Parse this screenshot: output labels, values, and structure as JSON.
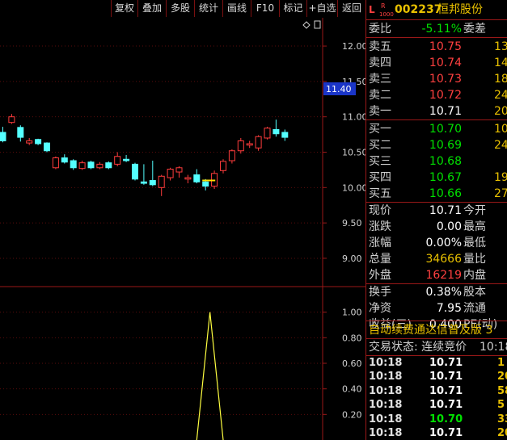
{
  "toolbar": {
    "items": [
      {
        "label": "复权"
      },
      {
        "label": "叠加"
      },
      {
        "label": "多股"
      },
      {
        "label": "统计"
      },
      {
        "label": "画线"
      },
      {
        "label": "F10"
      },
      {
        "label": "标记"
      },
      {
        "label": "+自选"
      },
      {
        "label": "返回"
      }
    ]
  },
  "chart": {
    "current_price_tag": "11.40",
    "price_axis": [
      "12.00",
      "11.50",
      "11.00",
      "10.50",
      "10.00",
      "9.50",
      "9.00"
    ],
    "indicator_axis": [
      "1.00",
      "0.80",
      "0.60",
      "0.40",
      "0.20"
    ]
  },
  "chart_data": {
    "type": "candlestick",
    "ylim": [
      8.6,
      12.4
    ],
    "candles": [
      {
        "o": 10.78,
        "h": 10.86,
        "l": 10.64,
        "c": 10.66
      },
      {
        "o": 10.92,
        "h": 11.04,
        "l": 10.9,
        "c": 11.0
      },
      {
        "o": 10.85,
        "h": 10.88,
        "l": 10.65,
        "c": 10.71
      },
      {
        "o": 10.63,
        "h": 10.7,
        "l": 10.6,
        "c": 10.66
      },
      {
        "o": 10.68,
        "h": 10.69,
        "l": 10.6,
        "c": 10.62
      },
      {
        "o": 10.63,
        "h": 10.64,
        "l": 10.5,
        "c": 10.52
      },
      {
        "o": 10.28,
        "h": 10.44,
        "l": 10.26,
        "c": 10.42
      },
      {
        "o": 10.42,
        "h": 10.47,
        "l": 10.34,
        "c": 10.36
      },
      {
        "o": 10.38,
        "h": 10.4,
        "l": 10.25,
        "c": 10.28
      },
      {
        "o": 10.27,
        "h": 10.38,
        "l": 10.25,
        "c": 10.35
      },
      {
        "o": 10.36,
        "h": 10.38,
        "l": 10.26,
        "c": 10.28
      },
      {
        "o": 10.28,
        "h": 10.36,
        "l": 10.26,
        "c": 10.33
      },
      {
        "o": 10.35,
        "h": 10.37,
        "l": 10.26,
        "c": 10.28
      },
      {
        "o": 10.33,
        "h": 10.5,
        "l": 10.3,
        "c": 10.44
      },
      {
        "o": 10.4,
        "h": 10.46,
        "l": 10.36,
        "c": 10.38
      },
      {
        "o": 10.33,
        "h": 10.35,
        "l": 10.1,
        "c": 10.12
      },
      {
        "o": 10.08,
        "h": 10.33,
        "l": 10.04,
        "c": 10.06
      },
      {
        "o": 10.1,
        "h": 10.38,
        "l": 10.02,
        "c": 10.04
      },
      {
        "o": 10.0,
        "h": 10.18,
        "l": 9.88,
        "c": 10.16
      },
      {
        "o": 10.14,
        "h": 10.28,
        "l": 10.1,
        "c": 10.26
      },
      {
        "o": 10.22,
        "h": 10.3,
        "l": 10.14,
        "c": 10.28
      },
      {
        "o": 10.12,
        "h": 10.18,
        "l": 10.06,
        "c": 10.14
      },
      {
        "o": 10.18,
        "h": 10.26,
        "l": 10.06,
        "c": 10.08
      },
      {
        "o": 10.08,
        "h": 10.12,
        "l": 9.96,
        "c": 10.02
      },
      {
        "o": 10.02,
        "h": 10.24,
        "l": 9.98,
        "c": 10.2
      },
      {
        "o": 10.24,
        "h": 10.4,
        "l": 10.2,
        "c": 10.37
      },
      {
        "o": 10.38,
        "h": 10.54,
        "l": 10.34,
        "c": 10.52
      },
      {
        "o": 10.52,
        "h": 10.7,
        "l": 10.48,
        "c": 10.66
      },
      {
        "o": 10.6,
        "h": 10.66,
        "l": 10.56,
        "c": 10.62
      },
      {
        "o": 10.56,
        "h": 10.74,
        "l": 10.52,
        "c": 10.72
      },
      {
        "o": 10.7,
        "h": 10.86,
        "l": 10.68,
        "c": 10.84
      },
      {
        "o": 10.82,
        "h": 10.96,
        "l": 10.72,
        "c": 10.76
      },
      {
        "o": 10.78,
        "h": 10.82,
        "l": 10.66,
        "c": 10.71
      }
    ],
    "highlight_index": 23,
    "highlight_price": 10.1,
    "indicator": {
      "ylim": [
        0,
        1.2
      ],
      "segments": [
        {
          "from_index": 22,
          "to_index": 25,
          "values": [
            0,
            1.0,
            0
          ]
        }
      ]
    }
  },
  "quote": {
    "stock_code": "002237",
    "stock_name": "恒邦股份",
    "tag_l": "L",
    "tag_r": "R",
    "tag_num": "1000",
    "webi_label": "委比",
    "webi_value": "-5.11%",
    "weicha_label": "委差",
    "sell": [
      {
        "label": "卖五",
        "price": "10.75",
        "vol": "13"
      },
      {
        "label": "卖四",
        "price": "10.74",
        "vol": "14"
      },
      {
        "label": "卖三",
        "price": "10.73",
        "vol": "18"
      },
      {
        "label": "卖二",
        "price": "10.72",
        "vol": "24"
      },
      {
        "label": "卖一",
        "price": "10.71",
        "vol": "20"
      }
    ],
    "buy": [
      {
        "label": "买一",
        "price": "10.70",
        "vol": "10"
      },
      {
        "label": "买二",
        "price": "10.69",
        "vol": "24"
      },
      {
        "label": "买三",
        "price": "10.68",
        "vol": ""
      },
      {
        "label": "买四",
        "price": "10.67",
        "vol": "19"
      },
      {
        "label": "买五",
        "price": "10.66",
        "vol": "27"
      }
    ],
    "stats": [
      {
        "label": "现价",
        "value": "10.71",
        "label2": "今开"
      },
      {
        "label": "涨跌",
        "value": "0.00",
        "label2": "最高"
      },
      {
        "label": "涨幅",
        "value": "0.00%",
        "label2": "最低"
      },
      {
        "label": "总量",
        "value": "34666",
        "label2": "量比"
      },
      {
        "label": "外盘",
        "value": "16219",
        "label2": "内盘"
      }
    ],
    "stats2": [
      {
        "label": "换手",
        "value": "0.38%",
        "label2": "股本"
      },
      {
        "label": "净资",
        "value": "7.95",
        "label2": "流通"
      },
      {
        "label": "收益(三)",
        "value": "0.400",
        "label2": "PE(动)"
      }
    ],
    "promo": "自动续费通达信普及版 3",
    "trade_status": "交易状态: 连续竞价",
    "trade_time": "10:18",
    "ticks": [
      {
        "time": "10:18",
        "price": "10.71",
        "vol": "1"
      },
      {
        "time": "10:18",
        "price": "10.71",
        "vol": "20"
      },
      {
        "time": "10:18",
        "price": "10.71",
        "vol": "58"
      },
      {
        "time": "10:18",
        "price": "10.71",
        "vol": "5"
      },
      {
        "time": "10:18",
        "price": "10.70",
        "vol": "33"
      },
      {
        "time": "10:18",
        "price": "10.71",
        "vol": "20"
      }
    ]
  }
}
